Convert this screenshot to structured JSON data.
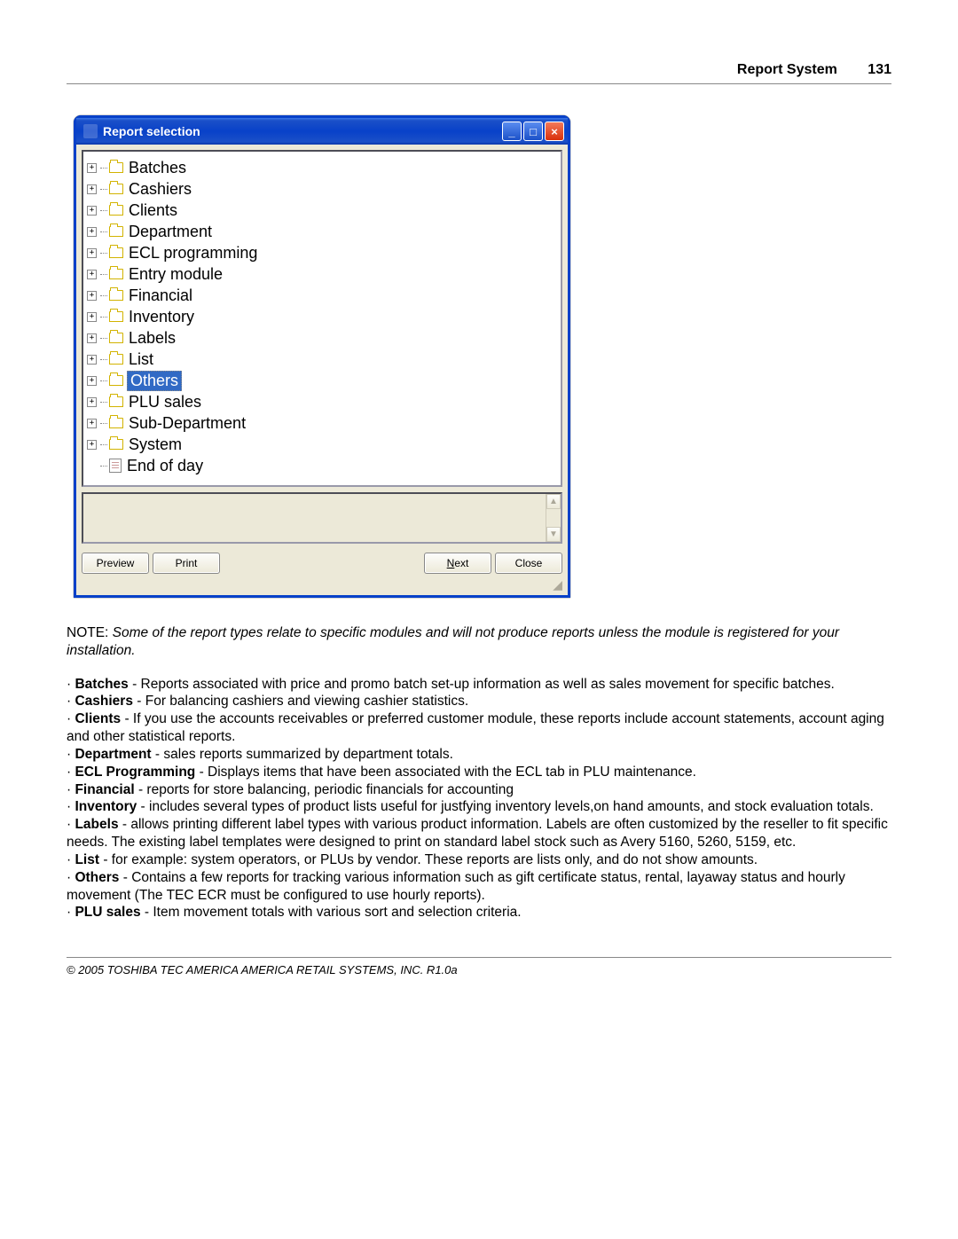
{
  "header": {
    "title": "Report System",
    "page": "131"
  },
  "window": {
    "title": "Report selection",
    "controls": {
      "min": "_",
      "max": "□",
      "close": "×"
    },
    "tree": [
      {
        "label": "Batches",
        "type": "folder",
        "expandable": true
      },
      {
        "label": "Cashiers",
        "type": "folder",
        "expandable": true
      },
      {
        "label": "Clients",
        "type": "folder",
        "expandable": true
      },
      {
        "label": "Department",
        "type": "folder",
        "expandable": true
      },
      {
        "label": "ECL programming",
        "type": "folder",
        "expandable": true
      },
      {
        "label": "Entry module",
        "type": "folder",
        "expandable": true
      },
      {
        "label": "Financial",
        "type": "folder",
        "expandable": true
      },
      {
        "label": "Inventory",
        "type": "folder",
        "expandable": true
      },
      {
        "label": "Labels",
        "type": "folder",
        "expandable": true
      },
      {
        "label": "List",
        "type": "folder",
        "expandable": true
      },
      {
        "label": "Others",
        "type": "folder",
        "expandable": true,
        "selected": true
      },
      {
        "label": "PLU sales",
        "type": "folder",
        "expandable": true
      },
      {
        "label": "Sub-Department",
        "type": "folder",
        "expandable": true
      },
      {
        "label": "System",
        "type": "folder",
        "expandable": true
      },
      {
        "label": "End of day",
        "type": "doc",
        "expandable": false
      }
    ],
    "buttons": {
      "preview": "Preview",
      "print": "Print",
      "next_pre": "N",
      "next_rest": "ext",
      "close": "Close"
    }
  },
  "note_prefix": "NOTE: ",
  "note_body": "Some of the report types relate to specific modules and will not produce reports unless the module is registered for your installation.",
  "descs": [
    {
      "term": "Batches",
      "text": "  - Reports associated with price and promo batch set-up information as well as sales movement for specific batches."
    },
    {
      "term": "Cashiers",
      "text": "  - For balancing cashiers and viewing cashier statistics."
    },
    {
      "term": "Clients",
      "text": "  - If you use the accounts receivables or preferred customer module, these reports include account statements, account aging and other statistical reports."
    },
    {
      "term": "Department",
      "text": "  - sales reports summarized by department totals."
    },
    {
      "term": "ECL Programming",
      "text": "  - Displays items that have been associated with the ECL tab in PLU maintenance."
    },
    {
      "term": "Financial",
      "text": "  - reports for store balancing, periodic financials for accounting"
    },
    {
      "term": "Inventory",
      "text": "  - includes several types of product lists useful for justfying inventory levels,on hand amounts, and stock evaluation totals."
    },
    {
      "term": "Labels",
      "text": "  - allows printing different label types with various product information. Labels are often customized by the reseller to fit specific needs. The existing label templates were designed to print on standard label stock such as Avery 5160, 5260, 5159, etc."
    },
    {
      "term": "List",
      "text": "  - for example: system operators, or PLUs by vendor. These reports are lists only, and do not show amounts."
    },
    {
      "term": "Others",
      "text": "  - Contains a few reports for tracking various information such as gift certificate status, rental, layaway status and hourly movement (The TEC ECR must be configured to use hourly reports)."
    },
    {
      "term": "PLU sales",
      "text": "  - Item movement totals with various sort and selection criteria."
    }
  ],
  "footer": "© 2005 TOSHIBA TEC AMERICA AMERICA RETAIL SYSTEMS, INC.   R1.0a"
}
